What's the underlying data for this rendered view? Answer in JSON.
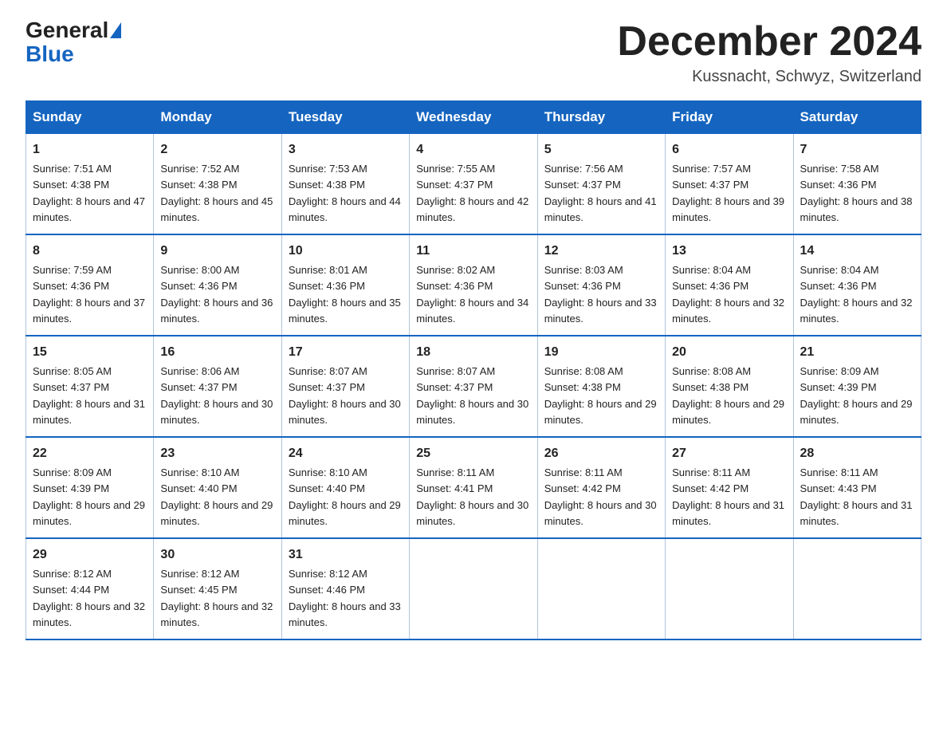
{
  "header": {
    "logo_general": "General",
    "logo_blue": "Blue",
    "month_title": "December 2024",
    "location": "Kussnacht, Schwyz, Switzerland"
  },
  "columns": [
    "Sunday",
    "Monday",
    "Tuesday",
    "Wednesday",
    "Thursday",
    "Friday",
    "Saturday"
  ],
  "weeks": [
    [
      {
        "day": "1",
        "sunrise": "7:51 AM",
        "sunset": "4:38 PM",
        "daylight": "8 hours and 47 minutes."
      },
      {
        "day": "2",
        "sunrise": "7:52 AM",
        "sunset": "4:38 PM",
        "daylight": "8 hours and 45 minutes."
      },
      {
        "day": "3",
        "sunrise": "7:53 AM",
        "sunset": "4:38 PM",
        "daylight": "8 hours and 44 minutes."
      },
      {
        "day": "4",
        "sunrise": "7:55 AM",
        "sunset": "4:37 PM",
        "daylight": "8 hours and 42 minutes."
      },
      {
        "day": "5",
        "sunrise": "7:56 AM",
        "sunset": "4:37 PM",
        "daylight": "8 hours and 41 minutes."
      },
      {
        "day": "6",
        "sunrise": "7:57 AM",
        "sunset": "4:37 PM",
        "daylight": "8 hours and 39 minutes."
      },
      {
        "day": "7",
        "sunrise": "7:58 AM",
        "sunset": "4:36 PM",
        "daylight": "8 hours and 38 minutes."
      }
    ],
    [
      {
        "day": "8",
        "sunrise": "7:59 AM",
        "sunset": "4:36 PM",
        "daylight": "8 hours and 37 minutes."
      },
      {
        "day": "9",
        "sunrise": "8:00 AM",
        "sunset": "4:36 PM",
        "daylight": "8 hours and 36 minutes."
      },
      {
        "day": "10",
        "sunrise": "8:01 AM",
        "sunset": "4:36 PM",
        "daylight": "8 hours and 35 minutes."
      },
      {
        "day": "11",
        "sunrise": "8:02 AM",
        "sunset": "4:36 PM",
        "daylight": "8 hours and 34 minutes."
      },
      {
        "day": "12",
        "sunrise": "8:03 AM",
        "sunset": "4:36 PM",
        "daylight": "8 hours and 33 minutes."
      },
      {
        "day": "13",
        "sunrise": "8:04 AM",
        "sunset": "4:36 PM",
        "daylight": "8 hours and 32 minutes."
      },
      {
        "day": "14",
        "sunrise": "8:04 AM",
        "sunset": "4:36 PM",
        "daylight": "8 hours and 32 minutes."
      }
    ],
    [
      {
        "day": "15",
        "sunrise": "8:05 AM",
        "sunset": "4:37 PM",
        "daylight": "8 hours and 31 minutes."
      },
      {
        "day": "16",
        "sunrise": "8:06 AM",
        "sunset": "4:37 PM",
        "daylight": "8 hours and 30 minutes."
      },
      {
        "day": "17",
        "sunrise": "8:07 AM",
        "sunset": "4:37 PM",
        "daylight": "8 hours and 30 minutes."
      },
      {
        "day": "18",
        "sunrise": "8:07 AM",
        "sunset": "4:37 PM",
        "daylight": "8 hours and 30 minutes."
      },
      {
        "day": "19",
        "sunrise": "8:08 AM",
        "sunset": "4:38 PM",
        "daylight": "8 hours and 29 minutes."
      },
      {
        "day": "20",
        "sunrise": "8:08 AM",
        "sunset": "4:38 PM",
        "daylight": "8 hours and 29 minutes."
      },
      {
        "day": "21",
        "sunrise": "8:09 AM",
        "sunset": "4:39 PM",
        "daylight": "8 hours and 29 minutes."
      }
    ],
    [
      {
        "day": "22",
        "sunrise": "8:09 AM",
        "sunset": "4:39 PM",
        "daylight": "8 hours and 29 minutes."
      },
      {
        "day": "23",
        "sunrise": "8:10 AM",
        "sunset": "4:40 PM",
        "daylight": "8 hours and 29 minutes."
      },
      {
        "day": "24",
        "sunrise": "8:10 AM",
        "sunset": "4:40 PM",
        "daylight": "8 hours and 29 minutes."
      },
      {
        "day": "25",
        "sunrise": "8:11 AM",
        "sunset": "4:41 PM",
        "daylight": "8 hours and 30 minutes."
      },
      {
        "day": "26",
        "sunrise": "8:11 AM",
        "sunset": "4:42 PM",
        "daylight": "8 hours and 30 minutes."
      },
      {
        "day": "27",
        "sunrise": "8:11 AM",
        "sunset": "4:42 PM",
        "daylight": "8 hours and 31 minutes."
      },
      {
        "day": "28",
        "sunrise": "8:11 AM",
        "sunset": "4:43 PM",
        "daylight": "8 hours and 31 minutes."
      }
    ],
    [
      {
        "day": "29",
        "sunrise": "8:12 AM",
        "sunset": "4:44 PM",
        "daylight": "8 hours and 32 minutes."
      },
      {
        "day": "30",
        "sunrise": "8:12 AM",
        "sunset": "4:45 PM",
        "daylight": "8 hours and 32 minutes."
      },
      {
        "day": "31",
        "sunrise": "8:12 AM",
        "sunset": "4:46 PM",
        "daylight": "8 hours and 33 minutes."
      },
      null,
      null,
      null,
      null
    ]
  ]
}
